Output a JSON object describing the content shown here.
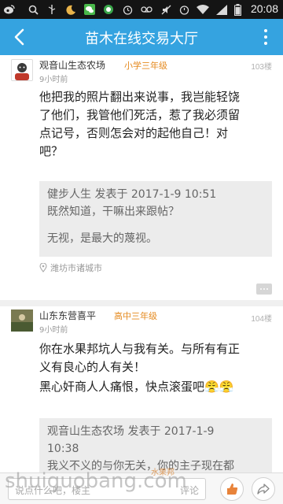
{
  "status_bar": {
    "time": "20:08",
    "icons": [
      "weibo-icon",
      "search-icon",
      "usb-icon",
      "moon-icon",
      "wechat-icon",
      "chat-bubble-icon",
      "alarm-icon",
      "voicemail-icon",
      "mute-icon",
      "alarm-icon",
      "wifi-icon",
      "signal-icon",
      "battery-icon"
    ]
  },
  "header": {
    "title": "苗木在线交易大厅",
    "back_icon": "back-arrow-icon",
    "more_icon": "more-vertical-icon",
    "accent_color": "#35a3e0"
  },
  "posts": [
    {
      "username": "观音山生态农场",
      "rank": "小学三年级",
      "time": "9小时前",
      "floor": "103楼",
      "body": [
        "他把我的照片翻出来说事，我岂能轻饶",
        "了他们，我管他们死活，惹了我必须留",
        "点记号，否则怎会对的起他自己！对",
        "吧？"
      ],
      "quote": {
        "header": "健步人生 发表于 2017-1-9 10:51",
        "lines": [
          "既然知道，干嘛出来跟帖？",
          "",
          "无视，是最大的蔑视。"
        ]
      },
      "location": "潍坊市诸城市"
    },
    {
      "username": "山东东营喜平",
      "rank": "高中三年级",
      "time": "9小时前",
      "floor": "104楼",
      "body": [
        "你在水果邦坑人与我有关。与所有有正",
        "义有良心的人有关！",
        "黑心奸商人人痛恨，快点滚蛋吧😤😤"
      ],
      "quote": {
        "header_line1": "观音山生态农场 发表于 2017-1-9",
        "header_line2": "10:38",
        "lines": [
          "我义不义的与你无关，你的主子现在都"
        ]
      }
    }
  ],
  "bottom_bar": {
    "comment_placeholder": "说点什么吧，楼主",
    "comment_suffix": "评论",
    "like_icon": "thumbs-up-icon",
    "share_icon": "share-icon"
  },
  "watermark": {
    "text": "shuiguobang.com",
    "cn_text": "水果邦"
  }
}
